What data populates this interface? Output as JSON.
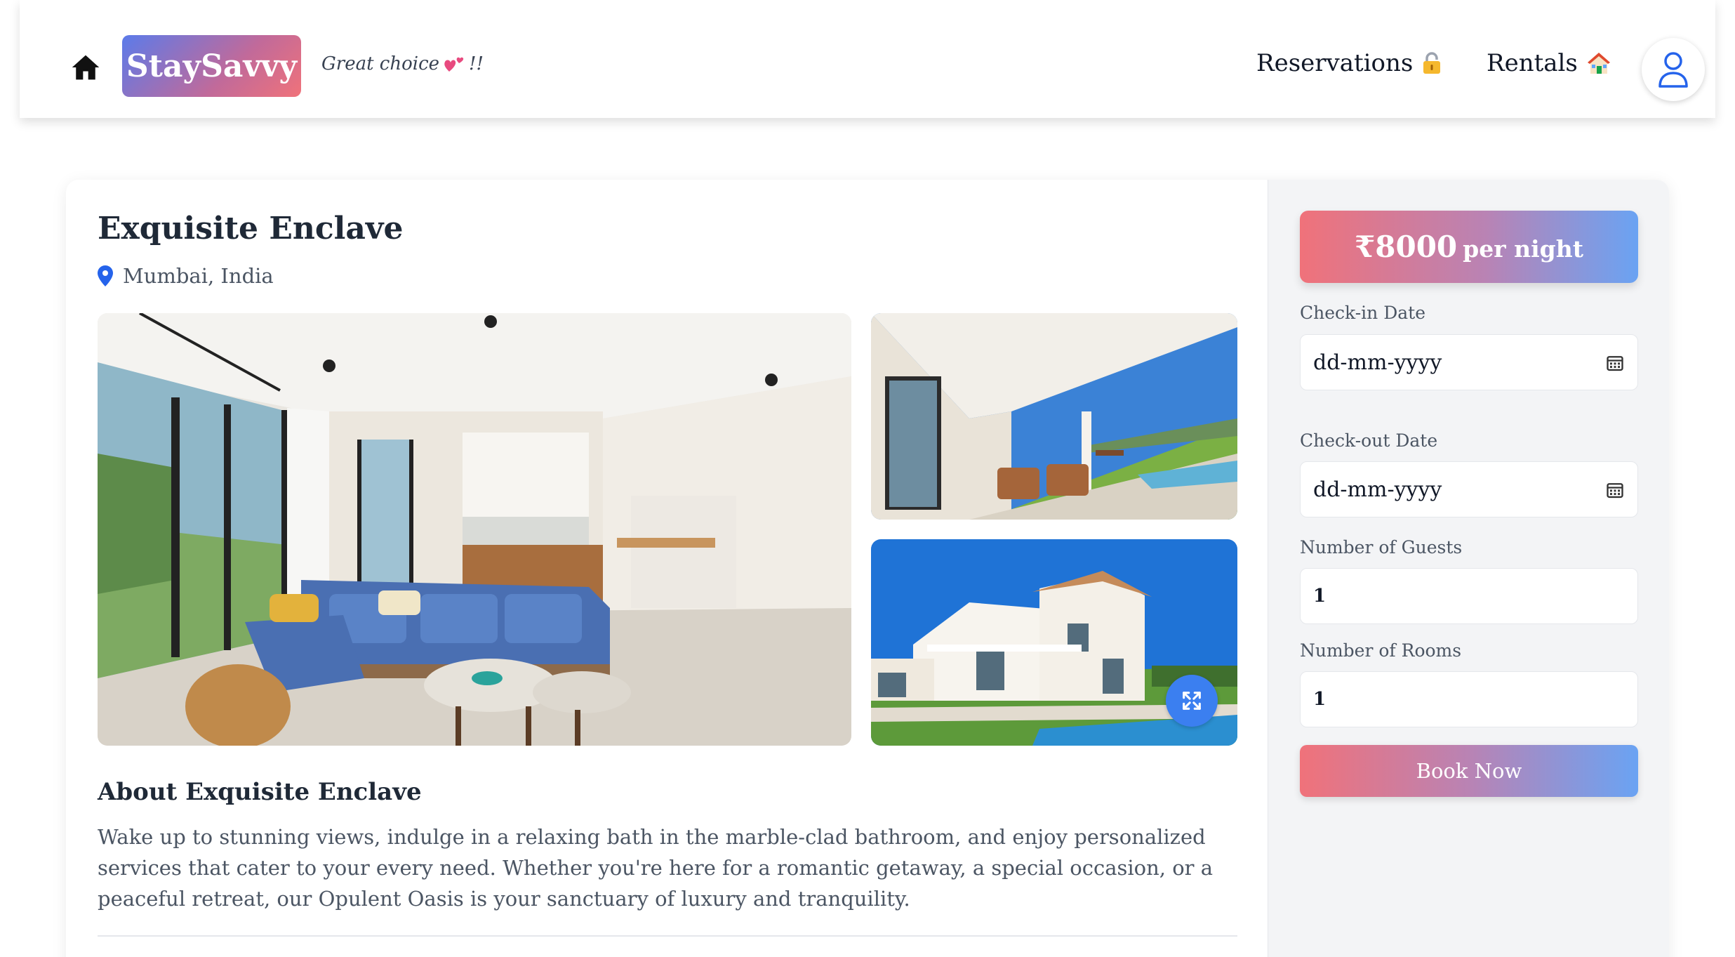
{
  "nav": {
    "brand": "StaySavvy",
    "tagline": "Great choice",
    "tagline_suffix": "!!",
    "links": [
      {
        "label": "Reservations",
        "icon": "lock-icon"
      },
      {
        "label": "Rentals",
        "icon": "house-icon"
      }
    ],
    "home_icon": "home-icon",
    "profile_icon": "user-icon"
  },
  "listing": {
    "title": "Exquisite Enclave",
    "location": "Mumbai, India",
    "images": [
      "living-room",
      "patio-terrace",
      "villa-exterior-pool"
    ],
    "about_title": "About Exquisite Enclave",
    "about_text": "Wake up to stunning views, indulge in a relaxing bath in the marble-clad bathroom, and enjoy personalized services that cater to your every need. Whether you're here for a romantic getaway, a special occasion, or a peaceful retreat, our Opulent Oasis is your sanctuary of luxury and tranquility."
  },
  "booking": {
    "price": "₹8000",
    "price_unit": "per night",
    "checkin_label": "Check-in Date",
    "checkin_value": "dd-mm-yyyy",
    "checkout_label": "Check-out Date",
    "checkout_value": "dd-mm-yyyy",
    "guests_label": "Number of Guests",
    "guests_value": "1",
    "rooms_label": "Number of Rooms",
    "rooms_value": "1",
    "book_label": "Book Now"
  },
  "colors": {
    "accent_blue": "#3b7ff0",
    "gradient_pink": "#f0727a",
    "gradient_blue": "#6aa3f3"
  }
}
